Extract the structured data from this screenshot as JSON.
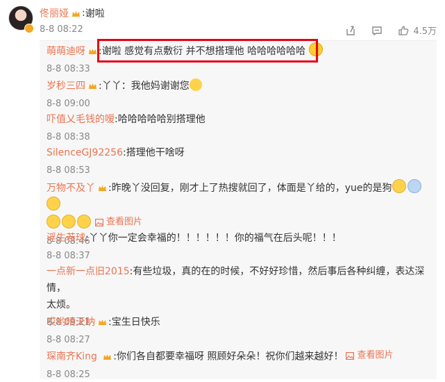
{
  "post": {
    "author": "佟丽娅",
    "content": "谢啦",
    "time": "8-8 08:22",
    "like_count": "4.5万"
  },
  "replies": [
    {
      "author": "萌萌迪呀",
      "crown": true,
      "text": "谢啦 感觉有点敷衍 并不想搭理他 哈哈哈哈哈哈",
      "emoji_after": [
        "laughcry"
      ],
      "time": "8-8 08:33"
    },
    {
      "author": "岁秒三四",
      "crown": true,
      "text": "丫丫：我他妈谢谢您",
      "emoji_after": [
        "smile"
      ],
      "time": "8-8 09:00"
    },
    {
      "author": "吓值乂毛钱的嗳",
      "crown": false,
      "text": "哈哈哈哈哈别搭理他",
      "time": "8-8 08:38"
    },
    {
      "author": "SilenceGJ92256",
      "crown": false,
      "text": "搭理他干啥呀",
      "time": "8-8 08:53"
    },
    {
      "author": "万物不及丫",
      "crown": true,
      "text": "昨晚丫没回复，刚才上了热搜就回了，体面是丫给的，yue的是狗",
      "line2": "查看图片",
      "time": "8-8 08:46"
    },
    {
      "author": "浮生若球",
      "crown": false,
      "text": "丫丫你一定会幸福的！！！！！！你的福气在后头呢！！！",
      "time": "8-8 08:37"
    },
    {
      "author": "一点新一点旧2015",
      "crown": false,
      "text": "有些垃圾，真的在的时候，不好好珍惜，然后事后各种纠缠，表达深情，",
      "line2": "太烦。",
      "time": "8-8 09:21"
    },
    {
      "author": "哎哟晴天呐",
      "crown": true,
      "text": "宝生日快乐",
      "time": "8-8 08:27"
    },
    {
      "author": "琛南齐King",
      "crown": true,
      "text": "你们各自都要幸福呀 照顾好朵朵！祝你们越来越好！",
      "viewpic": "查看图片",
      "time": "8-8 08:25"
    }
  ],
  "colors": {
    "name": "#eb7350",
    "highlight_box": "#e60012",
    "reply_bg": "#f7f7f7"
  }
}
